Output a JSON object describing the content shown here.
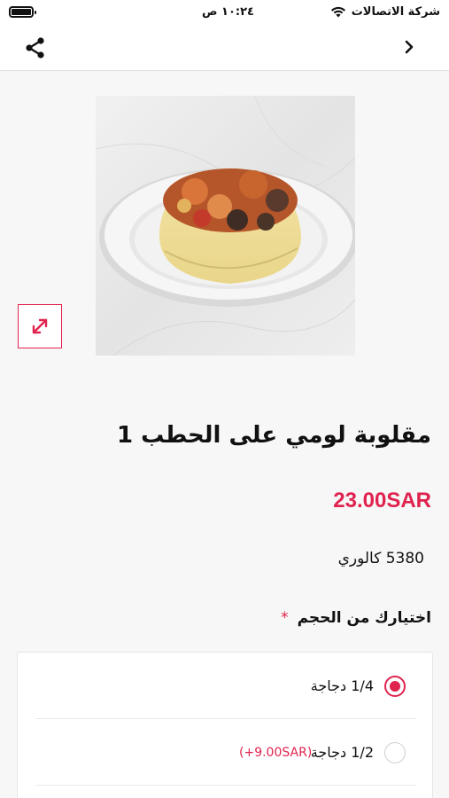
{
  "status_bar": {
    "carrier": "شركة الاتصالات",
    "time": "١٠:٢٤ ص"
  },
  "nav": {
    "share_icon": "share-icon",
    "back_icon": "chevron-right-icon"
  },
  "product": {
    "image_alt": "plate-of-rice-dish",
    "expand_icon": "expand-arrows-icon",
    "title": "مقلوبة لومي على الحطب 1",
    "price": "23.00SAR",
    "calories": "5380 كالوري"
  },
  "size_selection": {
    "title": "اختيارك من الحجم",
    "required_mark": "*",
    "options": [
      {
        "label": "1/4 دجاجة",
        "extra": "",
        "selected": true
      },
      {
        "label": "1/2 دجاجة",
        "extra": "(+9.00SAR)",
        "selected": false
      }
    ]
  },
  "colors": {
    "accent": "#e0234e",
    "background": "#f7f7f7"
  }
}
